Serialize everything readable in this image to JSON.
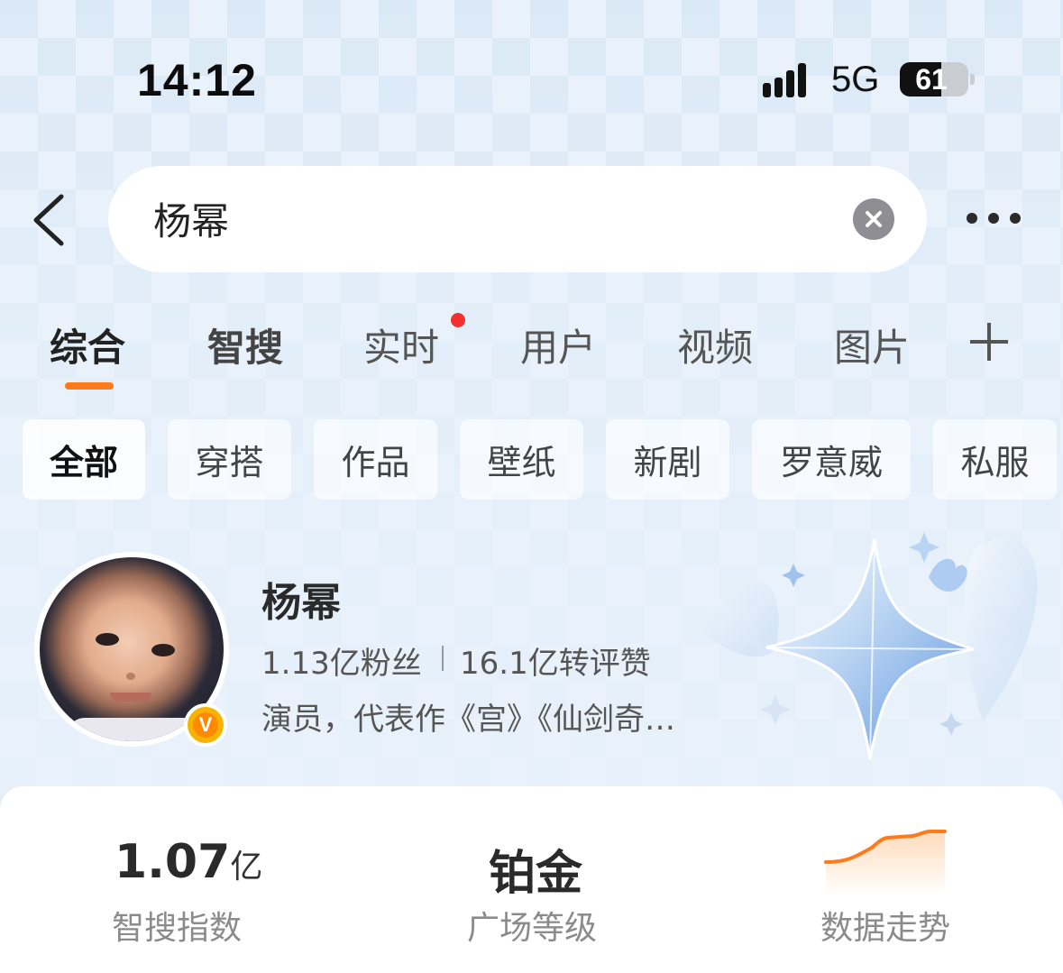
{
  "status_bar": {
    "time": "14:12",
    "network": "5G",
    "battery": "61",
    "battery_level": 0.61
  },
  "search": {
    "query": "杨幂",
    "clear_icon": "close-circle-icon",
    "back_icon": "chevron-left-icon",
    "more_icon": "ellipsis-icon"
  },
  "tabs": [
    {
      "label": "综合",
      "active": true
    },
    {
      "label": "智搜"
    },
    {
      "label": "实时",
      "has_dot": true
    },
    {
      "label": "用户"
    },
    {
      "label": "视频"
    },
    {
      "label": "图片"
    }
  ],
  "filters": [
    {
      "label": "全部",
      "active": true
    },
    {
      "label": "穿搭"
    },
    {
      "label": "作品"
    },
    {
      "label": "壁纸"
    },
    {
      "label": "新剧"
    },
    {
      "label": "罗意威"
    },
    {
      "label": "私服"
    }
  ],
  "profile": {
    "name": "杨幂",
    "fans": "1.13亿粉丝",
    "likes": "16.1亿转评赞",
    "description": "演员，代表作《宫》《仙剑奇…",
    "badge": "V"
  },
  "stats": [
    {
      "value": "1.07",
      "unit": "亿",
      "label": "智搜指数"
    },
    {
      "value": "铂金",
      "label": "广场等级"
    },
    {
      "label": "数据走势"
    }
  ],
  "colors": {
    "accent": "#ff7a1a",
    "notify_dot": "#f23030",
    "verified": "#f6b400"
  }
}
